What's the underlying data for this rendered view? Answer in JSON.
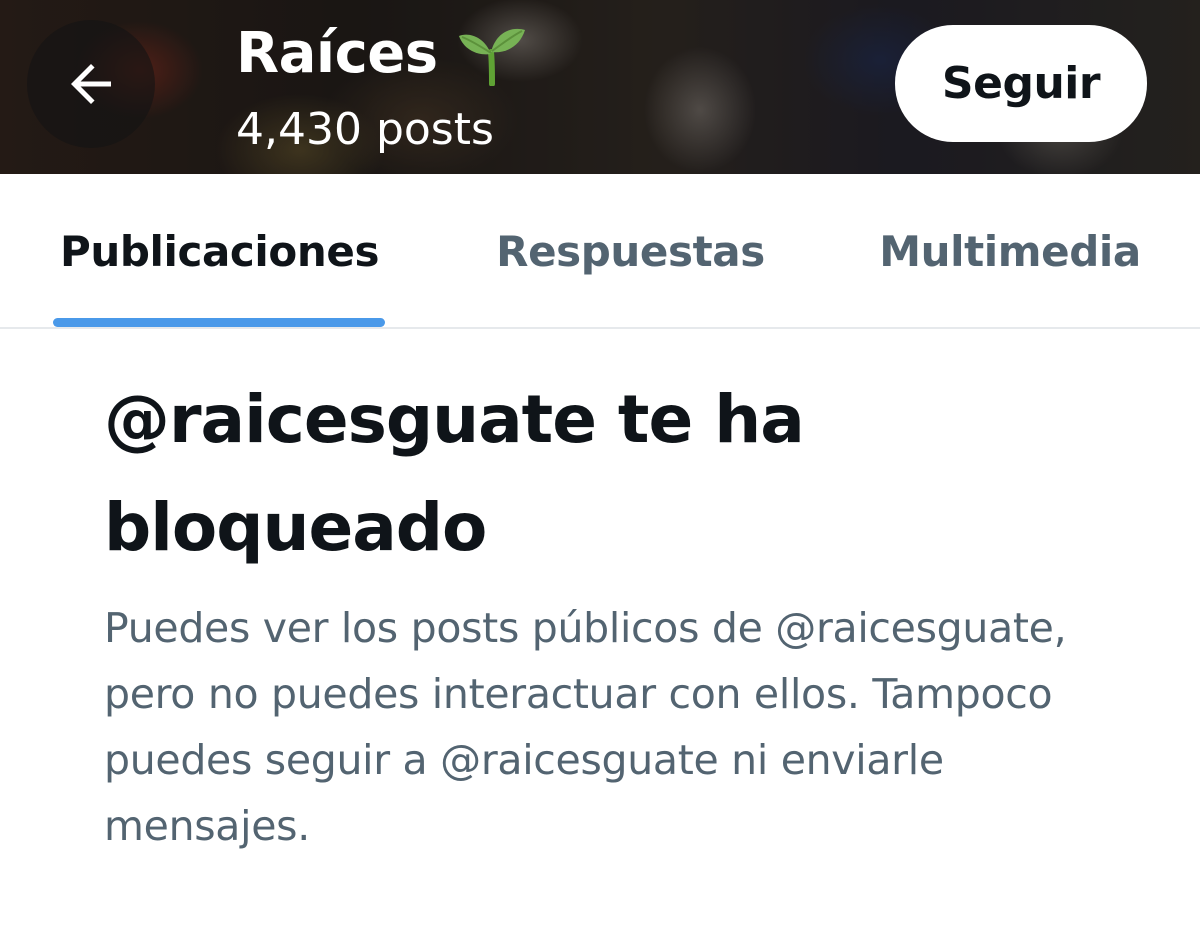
{
  "header": {
    "profile_name": "Raíces",
    "post_count": "4,430 posts",
    "follow_label": "Seguir",
    "back_icon": "arrow-left-icon",
    "name_emoji_icon": "seedling-icon"
  },
  "tabs": [
    {
      "label": "Publicaciones",
      "active": true
    },
    {
      "label": "Respuestas",
      "active": false
    },
    {
      "label": "Multimedia",
      "active": false
    }
  ],
  "blocked": {
    "title": "@raicesguate te ha bloqueado",
    "description": "Puedes ver los posts públicos de @raicesguate, pero no puedes interactuar con ellos. Tampoco puedes seguir a @raicesguate ni enviarle mensajes."
  },
  "colors": {
    "accent": "#4a99e9",
    "text_primary": "#0f1419",
    "text_secondary": "#536471"
  }
}
